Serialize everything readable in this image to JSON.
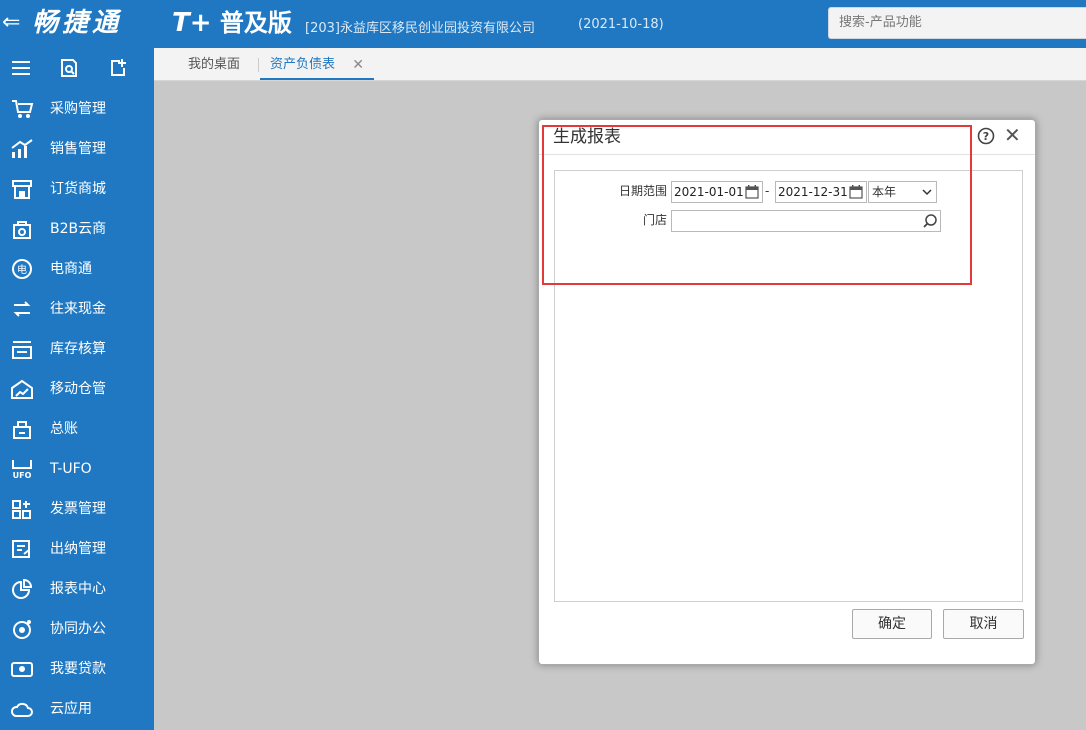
{
  "header": {
    "back_glyph": "⇐",
    "logo": "畅捷通",
    "product_tplus": "T+",
    "product_name": "普及版",
    "company": "[203]永益库区移民创业园投资有限公司",
    "date": "(2021-10-18)",
    "search_placeholder": "搜索-产品功能"
  },
  "sidebar": {
    "tools": [
      "menu-icon",
      "search-doc-icon",
      "new-doc-icon"
    ],
    "items": [
      {
        "label": "采购管理",
        "icon": "purchase-icon"
      },
      {
        "label": "销售管理",
        "icon": "sales-chart-icon"
      },
      {
        "label": "订货商城",
        "icon": "store-icon"
      },
      {
        "label": "B2B云商",
        "icon": "b2b-bag-icon"
      },
      {
        "label": "电商通",
        "icon": "ecommerce-icon"
      },
      {
        "label": "往来现金",
        "icon": "exchange-icon"
      },
      {
        "label": "库存核算",
        "icon": "inventory-icon"
      },
      {
        "label": "移动仓管",
        "icon": "mobile-warehouse-icon"
      },
      {
        "label": "总账",
        "icon": "ledger-icon"
      },
      {
        "label": "T-UFO",
        "icon": "ufo-icon"
      },
      {
        "label": "发票管理",
        "icon": "invoice-icon"
      },
      {
        "label": "出纳管理",
        "icon": "cashier-icon"
      },
      {
        "label": "报表中心",
        "icon": "report-pie-icon"
      },
      {
        "label": "协同办公",
        "icon": "collaboration-icon"
      },
      {
        "label": "我要贷款",
        "icon": "loan-icon"
      },
      {
        "label": "云应用",
        "icon": "cloud-icon"
      }
    ]
  },
  "tabs": {
    "home": "我的桌面",
    "balance": "资产负债表",
    "close_glyph": "✕"
  },
  "dialog": {
    "title": "生成报表",
    "help_glyph": "?",
    "close_glyph": "✕",
    "date_range_label": "日期范围",
    "date_from": "2021-01-01",
    "date_to": "2021-12-31",
    "separator": "-",
    "period_selected": "本年",
    "store_label": "门店",
    "store_value": "",
    "ok_label": "确定",
    "cancel_label": "取消"
  },
  "colors": {
    "brand_blue": "#1f78c1",
    "highlight_red": "#e03a3a"
  }
}
